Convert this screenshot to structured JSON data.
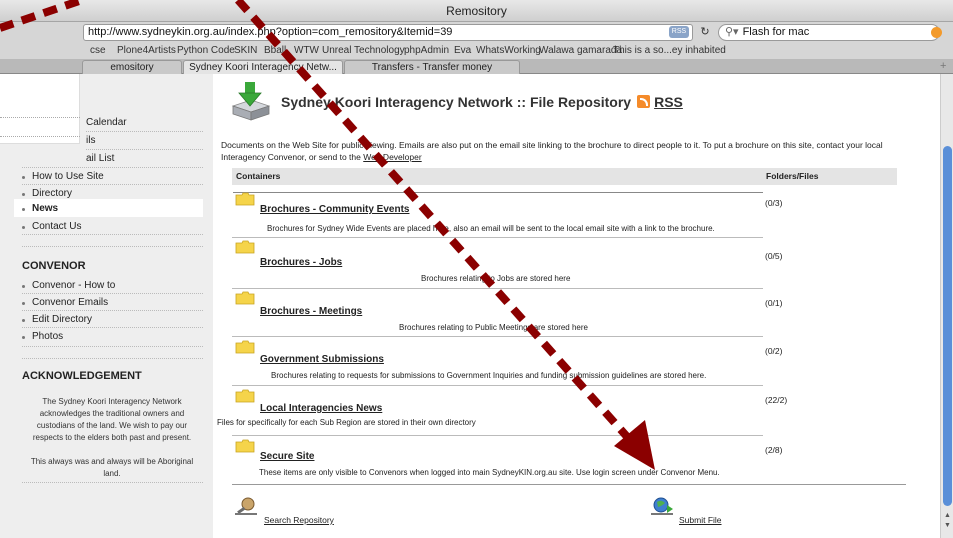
{
  "browser": {
    "window_title": "Remository",
    "url": "http://www.sydneykin.org.au/index.php?option=com_remository&Itemid=39",
    "rss_badge": "RSS",
    "search_value": "Flash for mac",
    "bookmarks": [
      "cse",
      "Plone4Artists",
      "Python Code",
      "SKIN",
      "Bball",
      "WTW",
      "Unreal Technology",
      "phpAdmin",
      "Eva",
      "WhatsWorking",
      "Walawa gamarada",
      "This is a so...ey inhabited"
    ],
    "tabs": [
      "emository",
      "Sydney Koori Interagency Netw...",
      "Transfers - Transfer money"
    ],
    "tab_plus": "+"
  },
  "sidebar": {
    "cut_items": [
      "Calendar",
      "ils",
      "ail List"
    ],
    "items": [
      "How to Use Site",
      "Directory",
      "News",
      "Contact Us"
    ],
    "convenor_heading": "CONVENOR",
    "convenor_items": [
      "Convenor - How to",
      "Convenor Emails",
      "Edit Directory",
      "Photos"
    ],
    "ack_heading": "ACKNOWLEDGEMENT",
    "ack_text": "The Sydney Koori Interagency Network acknowledges the traditional owners and custodians of the land. We wish to pay our respects to the elders both past and present.",
    "ack_text2": "This always was and always will be Aboriginal land."
  },
  "main": {
    "title": "Sydney Koori Interagency Network :: File Repository",
    "rss_label": "RSS",
    "intro": "Documents on the Web Site for public viewing. Emails are also put on the email site linking to the brochure to direct people to it. To put a brochure on this site, contact your local Interagency Convenor, or send to the",
    "intro_link": "Web Developer",
    "col_containers": "Containers",
    "col_folders": "Folders/Files",
    "containers": [
      {
        "title": "Brochures - Community Events",
        "count": "(0/3)",
        "desc": "Brochures for Sydney Wide Events are placed here, also an email will be sent to the local email site with a link to the brochure."
      },
      {
        "title": "Brochures - Jobs",
        "count": "(0/5)",
        "desc": "Brochures relating to Jobs are stored here"
      },
      {
        "title": "Brochures - Meetings",
        "count": "(0/1)",
        "desc": "Brochures relating to Public Meetings are stored here"
      },
      {
        "title": "Government Submissions",
        "count": "(0/2)",
        "desc": "Brochures relating to requests for submissions to Government Inquiries and funding submission guidelines are stored here."
      },
      {
        "title": "Local Interagencies News",
        "count": "(22/2)",
        "desc": "Files for specifically for each Sub Region are stored in their own directory"
      },
      {
        "title": "Secure Site",
        "count": "(2/8)",
        "desc": "These items are only visible to Convenors when logged into main SydneyKIN.org.au site. Use login screen under Convenor Menu."
      }
    ],
    "search_repo": "Search Repository",
    "submit_file": "Submit File"
  },
  "colors": {
    "accent": "#8b0000",
    "scroll_thumb": "#5a8fd8",
    "folder": "#f5d44a"
  }
}
